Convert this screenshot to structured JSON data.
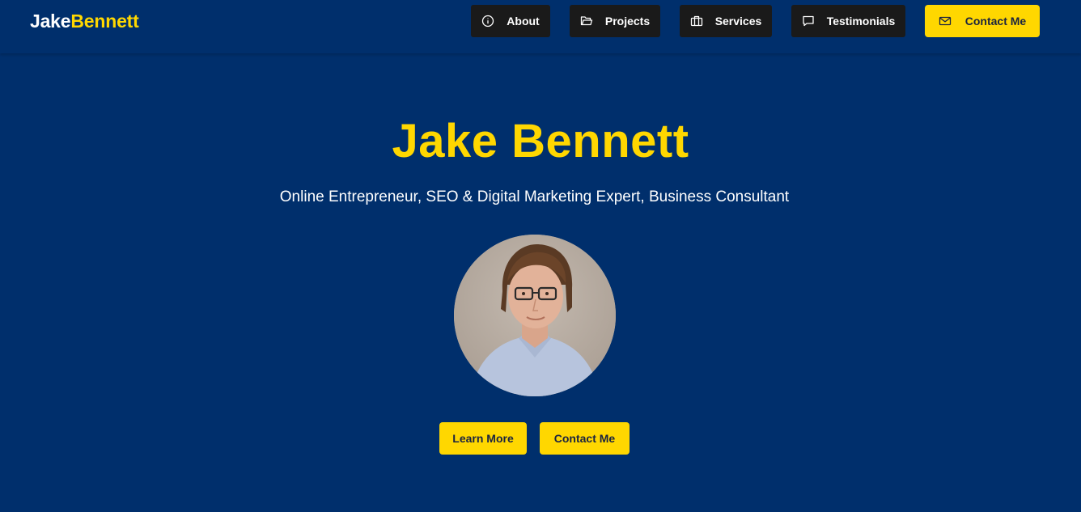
{
  "brand": {
    "first": "Jake",
    "last": "Bennett"
  },
  "nav": {
    "about": {
      "label": "About",
      "icon": "info-icon"
    },
    "projects": {
      "label": "Projects",
      "icon": "folder-icon"
    },
    "services": {
      "label": "Services",
      "icon": "briefcase-icon"
    },
    "testimonials": {
      "label": "Testimonials",
      "icon": "chat-icon"
    },
    "contact": {
      "label": "Contact Me",
      "icon": "mail-icon"
    }
  },
  "hero": {
    "name": "Jake Bennett",
    "tagline": "Online Entrepreneur, SEO & Digital Marketing Expert, Business Consultant",
    "primary_cta": "Learn More",
    "secondary_cta": "Contact Me"
  },
  "colors": {
    "background": "#002F6C",
    "accent": "#FFD700",
    "nav_button": "#1A1A1A",
    "text_light": "#FFFFFF"
  }
}
